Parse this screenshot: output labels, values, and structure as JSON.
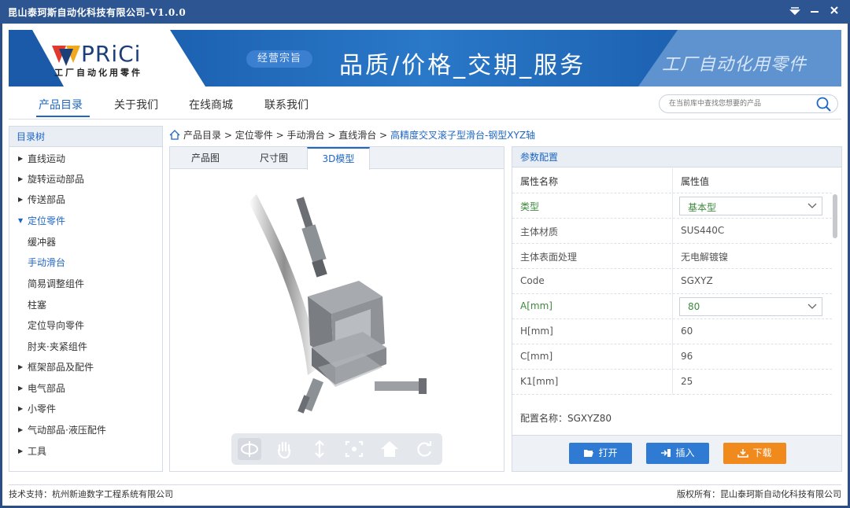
{
  "window": {
    "title": "昆山泰珂斯自动化科技有限公司-V1.0.0"
  },
  "banner": {
    "logo_text": "PRiCi",
    "logo_sub": "工厂自动化用零件",
    "motto_badge": "经营宗旨",
    "slogan": "品质/价格_交期_服务",
    "right_text": "工厂自动化用零件"
  },
  "nav": {
    "items": [
      "产品目录",
      "关于我们",
      "在线商城",
      "联系我们"
    ],
    "search_placeholder": "在当前库中查找您想要的产品"
  },
  "tree": {
    "title": "目录树",
    "items": [
      {
        "label": "直线运动",
        "arrow": "▶"
      },
      {
        "label": "旋转运动部品",
        "arrow": "▶"
      },
      {
        "label": "传送部品",
        "arrow": "▶"
      },
      {
        "label": "定位零件",
        "arrow": "▼"
      },
      {
        "label": "缓冲器",
        "arrow": ""
      },
      {
        "label": "手动滑台",
        "arrow": ""
      },
      {
        "label": "简易调整组件",
        "arrow": ""
      },
      {
        "label": "柱塞",
        "arrow": ""
      },
      {
        "label": "定位导向零件",
        "arrow": ""
      },
      {
        "label": "肘夹·夹紧组件",
        "arrow": ""
      },
      {
        "label": "框架部品及配件",
        "arrow": "▶"
      },
      {
        "label": "电气部品",
        "arrow": "▶"
      },
      {
        "label": "小零件",
        "arrow": "▶"
      },
      {
        "label": "气动部品·液压配件",
        "arrow": "▶"
      },
      {
        "label": "工具",
        "arrow": "▶"
      }
    ]
  },
  "breadcrumb": {
    "parts": [
      "产品目录",
      "定位零件",
      "手动滑台",
      "直线滑台"
    ],
    "separator": ">",
    "current": "高精度交叉滚子型滑台-钢型XYZ轴"
  },
  "preview": {
    "tabs": [
      "产品图",
      "尺寸图",
      "3D模型"
    ]
  },
  "params": {
    "title": "参数配置",
    "col_name": "属性名称",
    "col_value": "属性值",
    "rows": [
      {
        "name": "类型",
        "value": "基本型"
      },
      {
        "name": "主体材质",
        "value": "SUS440C"
      },
      {
        "name": "主体表面处理",
        "value": "无电解镀镍"
      },
      {
        "name": "Code",
        "value": "SGXYZ"
      },
      {
        "name": "A[mm]",
        "value": "80"
      },
      {
        "name": "H[mm]",
        "value": "60"
      },
      {
        "name": "C[mm]",
        "value": "96"
      },
      {
        "name": "K1[mm]",
        "value": "25"
      }
    ],
    "config_label": "配置名称：",
    "config_value": "SGXYZ80",
    "buttons": {
      "open": "打开",
      "insert": "插入",
      "download": "下载"
    }
  },
  "footer": {
    "left": "技术支持：杭州新迪数字工程系统有限公司",
    "right": "版权所有：昆山泰珂斯自动化科技有限公司"
  },
  "colors": {
    "accent": "#1f66c2",
    "title_bar": "#2d5591",
    "download": "#f08a1c",
    "open_insert": "#2f7ad3",
    "selectable_param": "#3c8a3c"
  }
}
